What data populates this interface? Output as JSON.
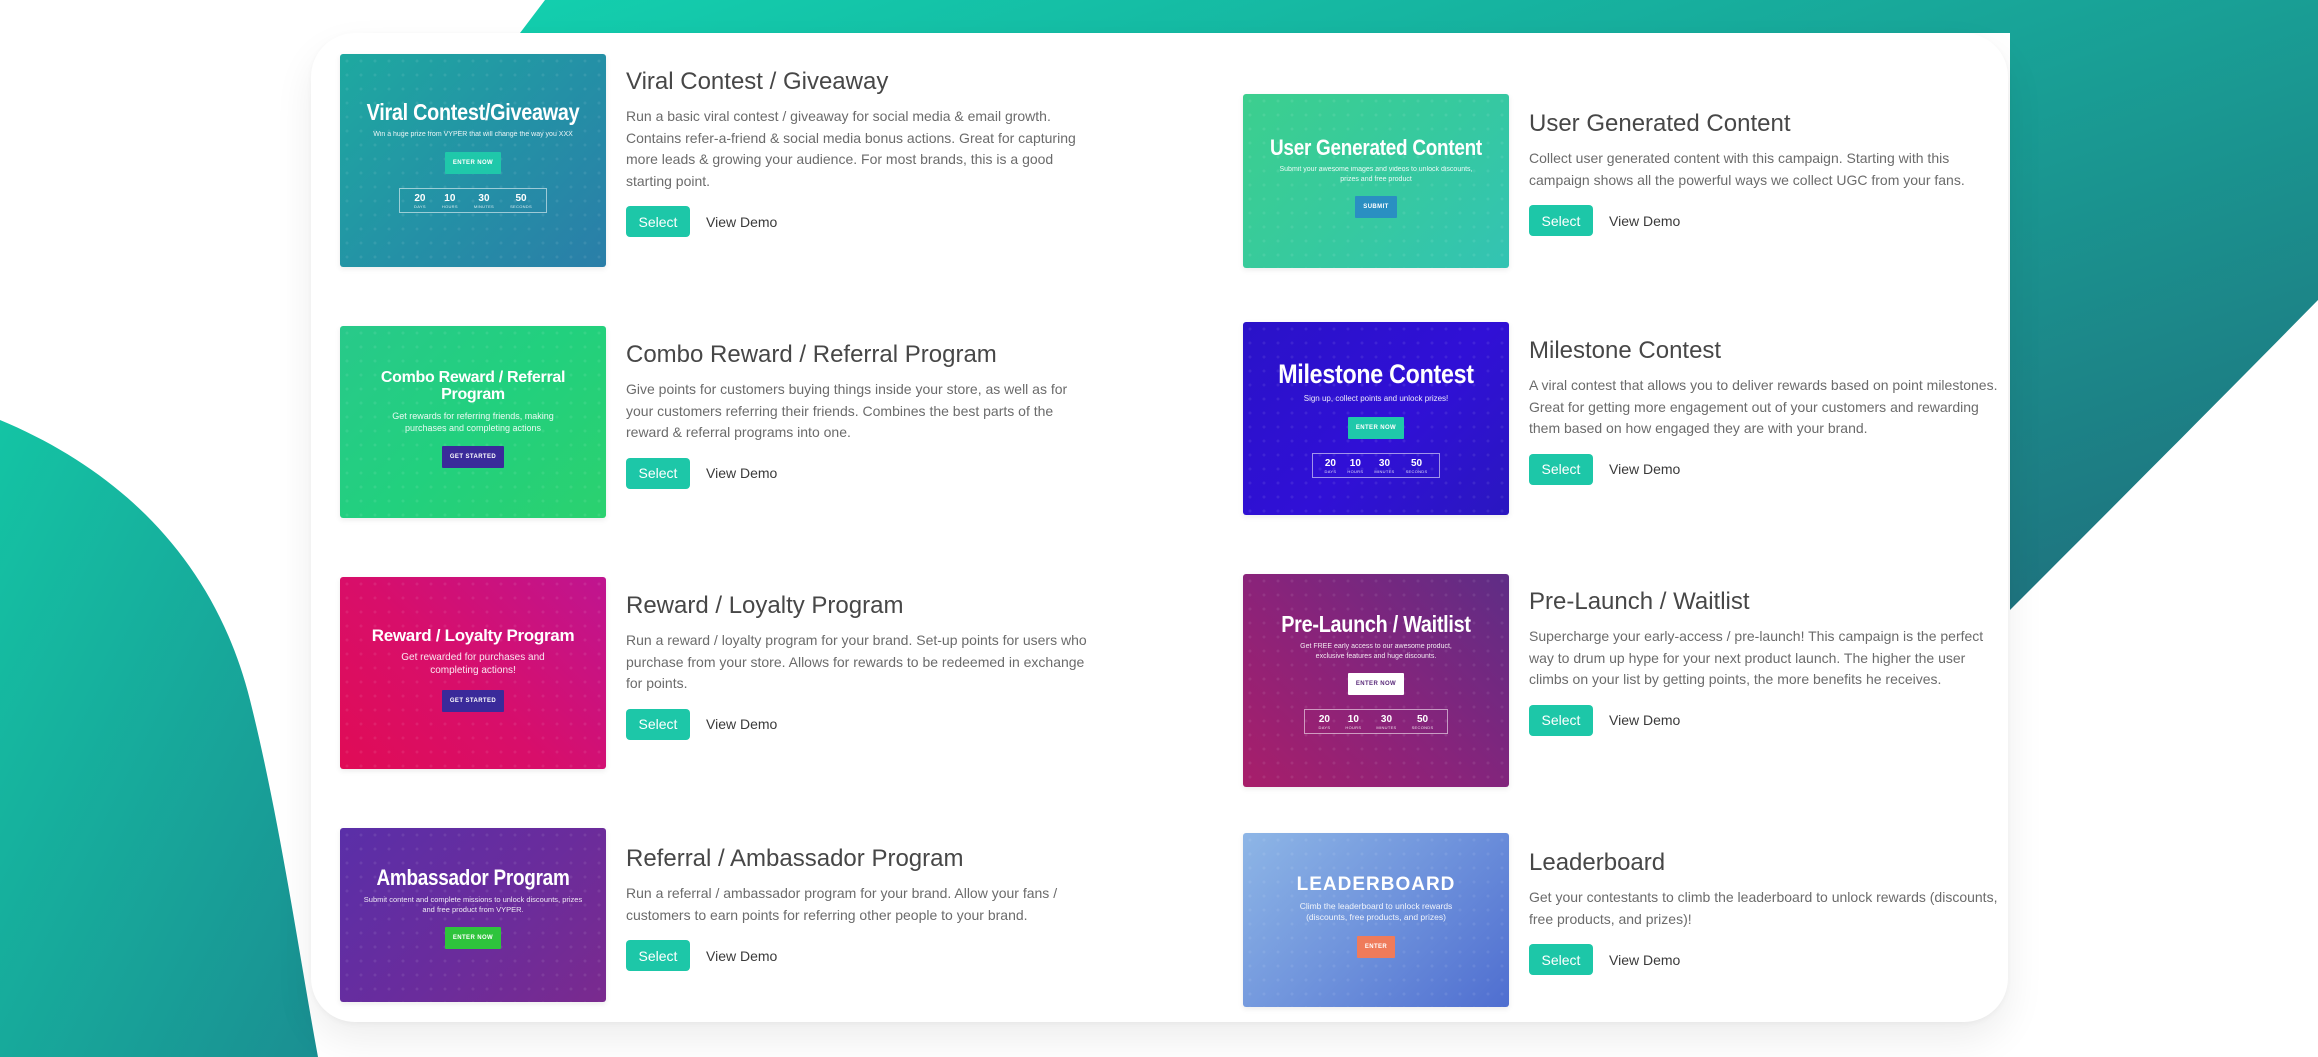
{
  "colors": {
    "accent": "#1dc7a8",
    "teal_gradient_start": "#16c9a6",
    "teal_gradient_end": "#1f6e7c"
  },
  "left_column": [
    {
      "title": "Viral Contest / Giveaway",
      "description": "Run a basic viral contest / giveaway for social media & email growth. Contains refer-a-friend & social media bonus actions. Great for capturing more leads & growing your audience. For most brands, this is a good starting point.",
      "select_label": "Select",
      "demo_label": "View Demo",
      "thumb": {
        "title": "Viral Contest/Giveaway",
        "subtitle": "Win a huge prize from VYPER that will change the way you XXX",
        "button": "ENTER NOW",
        "countdown": [
          {
            "value": "20",
            "label": "DAYS"
          },
          {
            "value": "10",
            "label": "HOURS"
          },
          {
            "value": "30",
            "label": "MINUTES"
          },
          {
            "value": "50",
            "label": "SECONDS"
          }
        ]
      }
    },
    {
      "title": "Combo Reward / Referral Program",
      "description": "Give points for customers buying things inside your store, as well as for your customers referring their friends. Combines the best parts of the reward & referral programs into one.",
      "select_label": "Select",
      "demo_label": "View Demo",
      "thumb": {
        "title": "Combo Reward / Referral Program",
        "subtitle": "Get rewards for referring friends, making purchases and completing actions",
        "button": "GET STARTED"
      }
    },
    {
      "title": "Reward / Loyalty Program",
      "description": "Run a reward / loyalty program for your brand. Set-up points for users who purchase from your store. Allows for rewards to be redeemed in exchange for points.",
      "select_label": "Select",
      "demo_label": "View Demo",
      "thumb": {
        "title": "Reward / Loyalty Program",
        "subtitle": "Get rewarded for purchases and completing actions!",
        "button": "GET STARTED"
      }
    },
    {
      "title": "Referral / Ambassador Program",
      "description": "Run a referral / ambassador program for your brand. Allow your fans / customers to earn points for referring other people to your brand.",
      "select_label": "Select",
      "demo_label": "View Demo",
      "thumb": {
        "title": "Ambassador Program",
        "subtitle": "Submit content and complete missions to unlock discounts, prizes and free product from VYPER.",
        "button": "ENTER NOW"
      }
    }
  ],
  "right_column": [
    {
      "title": "User Generated Content",
      "description": "Collect user generated content with this campaign. Starting with this campaign shows all the powerful ways we collect UGC from your fans.",
      "select_label": "Select",
      "demo_label": "View Demo",
      "thumb": {
        "title": "User Generated Content",
        "subtitle": "Submit your awesome images and videos to unlock discounts, prizes and free product",
        "button": "SUBMIT"
      }
    },
    {
      "title": "Milestone Contest",
      "description": "A viral contest that allows you to deliver rewards based on point milestones. Great for getting more engagement out of your customers and rewarding them based on how engaged they are with your brand.",
      "select_label": "Select",
      "demo_label": "View Demo",
      "thumb": {
        "title": "Milestone Contest",
        "subtitle": "Sign up, collect points and unlock prizes!",
        "button": "ENTER NOW",
        "countdown": [
          {
            "value": "20",
            "label": "DAYS"
          },
          {
            "value": "10",
            "label": "HOURS"
          },
          {
            "value": "30",
            "label": "MINUTES"
          },
          {
            "value": "50",
            "label": "SECONDS"
          }
        ]
      }
    },
    {
      "title": "Pre-Launch / Waitlist",
      "description": "Supercharge your early-access / pre-launch! This campaign is the perfect way to drum up hype for your next product launch. The higher the user climbs on your list by getting points, the more benefits he receives.",
      "select_label": "Select",
      "demo_label": "View Demo",
      "thumb": {
        "title": "Pre-Launch / Waitlist",
        "subtitle": "Get FREE early access to our awesome product, exclusive features and huge discounts.",
        "button": "ENTER NOW",
        "countdown": [
          {
            "value": "20",
            "label": "DAYS"
          },
          {
            "value": "10",
            "label": "HOURS"
          },
          {
            "value": "30",
            "label": "MINUTES"
          },
          {
            "value": "50",
            "label": "SECONDS"
          }
        ]
      }
    },
    {
      "title": "Leaderboard",
      "description": "Get your contestants to climb the leaderboard to unlock rewards (discounts, free products, and prizes)!",
      "select_label": "Select",
      "demo_label": "View Demo",
      "thumb": {
        "title": "LEADERBOARD",
        "subtitle": "Climb the leaderboard to unlock rewards (discounts, free products, and prizes)",
        "button": "ENTER"
      }
    }
  ]
}
